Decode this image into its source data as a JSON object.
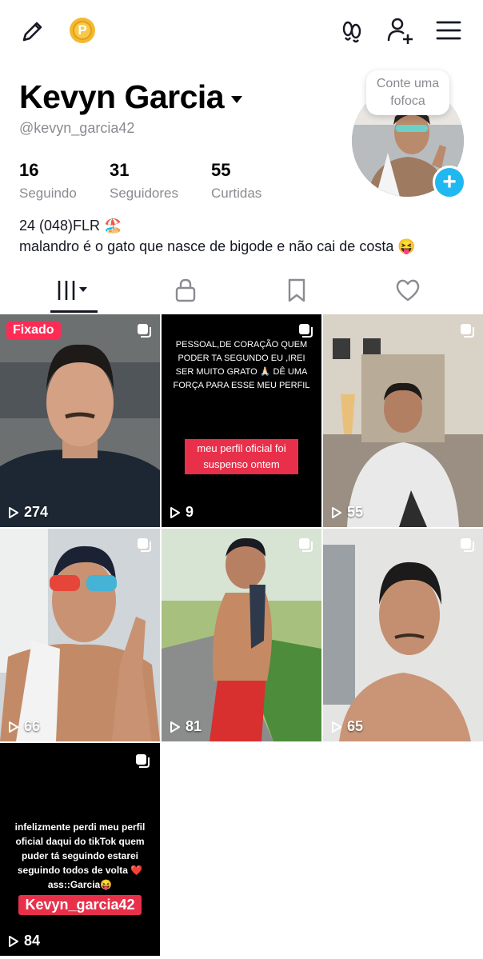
{
  "header": {
    "edit_icon": "pencil-icon",
    "coin_letter": "P",
    "footprint_icon": "footprints-icon",
    "add_friend_icon": "add-user-icon",
    "menu_icon": "hamburger-menu-icon"
  },
  "profile": {
    "name": "Kevyn Garcia",
    "handle": "@kevyn_garcia42",
    "bubble_text": "Conte uma fofoca",
    "stats": [
      {
        "value": "16",
        "label": "Seguindo"
      },
      {
        "value": "31",
        "label": "Seguidores"
      },
      {
        "value": "55",
        "label": "Curtidas"
      }
    ],
    "bio_line1": "24 (048)FLR 🏖️",
    "bio_line2": "malandro é o gato que nasce de bigode e não cai de costa 😝"
  },
  "tabs": [
    {
      "icon": "videos-grid-icon",
      "active": true
    },
    {
      "icon": "lock-icon",
      "active": false
    },
    {
      "icon": "bookmark-icon",
      "active": false
    },
    {
      "icon": "heart-icon",
      "active": false
    }
  ],
  "videos": [
    {
      "views": "274",
      "pinned_label": "Fixado"
    },
    {
      "views": "9",
      "caption": "PESSOAL,DE CORAÇÃO QUEM PODER TA SEGUNDO EU ,IREI SER MUITO GRATO 🙏🏻 DÊ UMA FORÇA PARA ESSE MEU PERFIL",
      "label": "meu perfil oficial foi suspenso ontem"
    },
    {
      "views": "55"
    },
    {
      "views": "66"
    },
    {
      "views": "81"
    },
    {
      "views": "65"
    },
    {
      "views": "84",
      "caption": "infelizmente perdi meu perfil oficial daqui do tikTok quem puder tá seguindo estarei seguindo todos de volta ❤️ass::Garcia😝",
      "label": "Kevyn_garcia42"
    }
  ],
  "colors": {
    "accent_red": "#fe2c55",
    "add_blue": "#20b8f0",
    "coin_gold": "#f5b82e"
  }
}
